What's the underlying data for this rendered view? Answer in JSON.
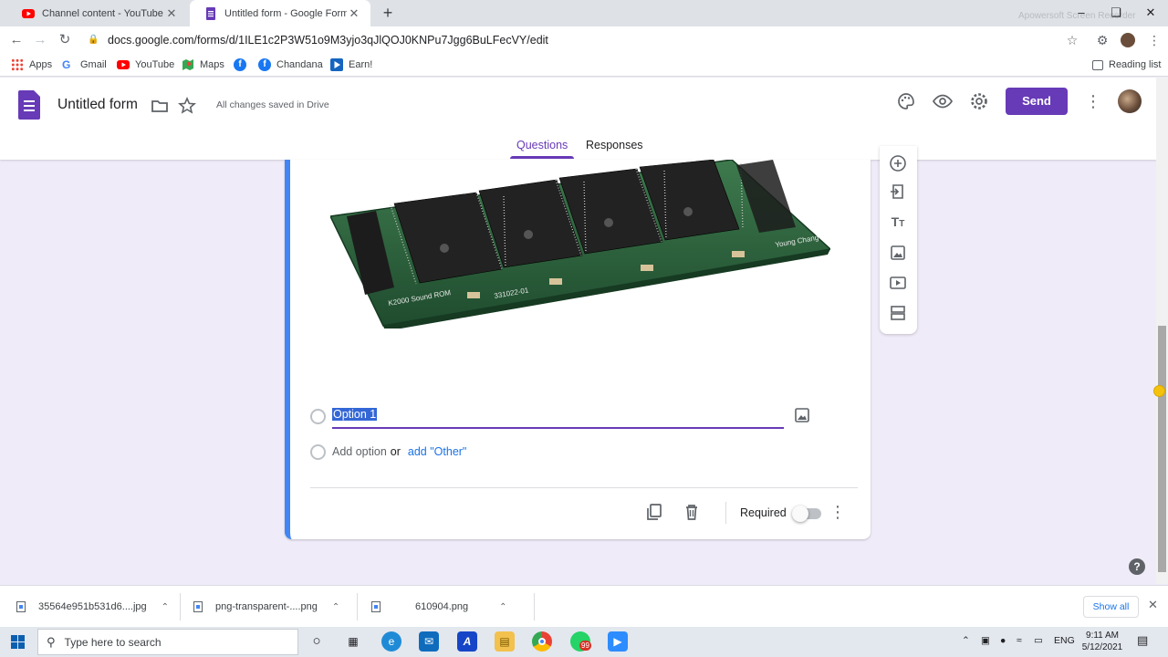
{
  "browser": {
    "tabs": [
      {
        "title": "Channel content - YouTube Studio",
        "close": "✕"
      },
      {
        "title": "Untitled form - Google Forms",
        "close": "✕"
      }
    ],
    "new_tab": "+",
    "url": "docs.google.com/forms/d/1ILE1c2P3W51o9M3yjo3qJlQOJ0KNPu7Jgg6BuLFecVY/edit",
    "watermark": "Apowersoft Screen Recorder",
    "bookmarks": [
      "Apps",
      "Gmail",
      "YouTube",
      "Maps",
      "Chandana",
      "Earn!"
    ],
    "reading_list": "Reading list"
  },
  "form": {
    "title": "Untitled form",
    "saved_status": "All changes saved in Drive",
    "send_label": "Send",
    "tabs": [
      "Questions",
      "Responses"
    ],
    "option1": "Option 1",
    "add_option": "Add option",
    "or": "or",
    "add_other": "add \"Other\"",
    "required_label": "Required",
    "required": false,
    "accent": "#673ab7"
  },
  "downloads": {
    "items": [
      "35564e951b531d6....jpg",
      "png-transparent-....png",
      "610904.png"
    ],
    "show_all": "Show all"
  },
  "taskbar": {
    "search_placeholder": "Type here to search",
    "lang": "ENG",
    "time": "9:11 AM",
    "date": "5/12/2021",
    "whatsapp_badge": "99"
  }
}
